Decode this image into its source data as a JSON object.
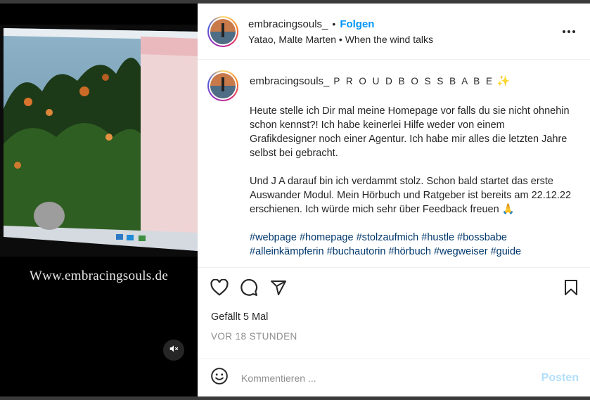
{
  "post": {
    "username": "embracingsouls_",
    "follow_label": "Folgen",
    "separator": "•",
    "subtitle": "Yatao, Malte Marten • When the wind talks",
    "more_icon": "more-horizontal-icon"
  },
  "media": {
    "watermark": "Www.embracingsouls.de",
    "mute_icon": "speaker-muted-icon"
  },
  "caption": {
    "username": "embracingsouls_",
    "tagline": "P R O U D B O S S B A B E",
    "tagline_emoji": "✨",
    "paragraph1": "Heute stelle ich Dir mal meine Homepage vor falls du sie nicht ohnehin schon kennst?! Ich habe keinerlei Hilfe weder von einem Grafikdesigner noch einer Agentur. Ich habe mir alles die letzten Jahre selbst bei gebracht.",
    "paragraph2": "Und J A darauf bin ich verdammt stolz. Schon bald startet das erste Auswander Modul. Mein Hörbuch und Ratgeber ist bereits am 22.12.22 erschienen. Ich würde mich sehr über Feedback freuen 🙏",
    "hashtags": "#webpage #homepage #stolzaufmich #hustle #bossbabe #alleinkämpferin #buchautorin #hörbuch #wegweiser #guide"
  },
  "actions": {
    "likes": "Gefällt 5 Mal",
    "time": "VOR 18 STUNDEN"
  },
  "comment": {
    "placeholder": "Kommentieren ...",
    "post_label": "Posten"
  }
}
